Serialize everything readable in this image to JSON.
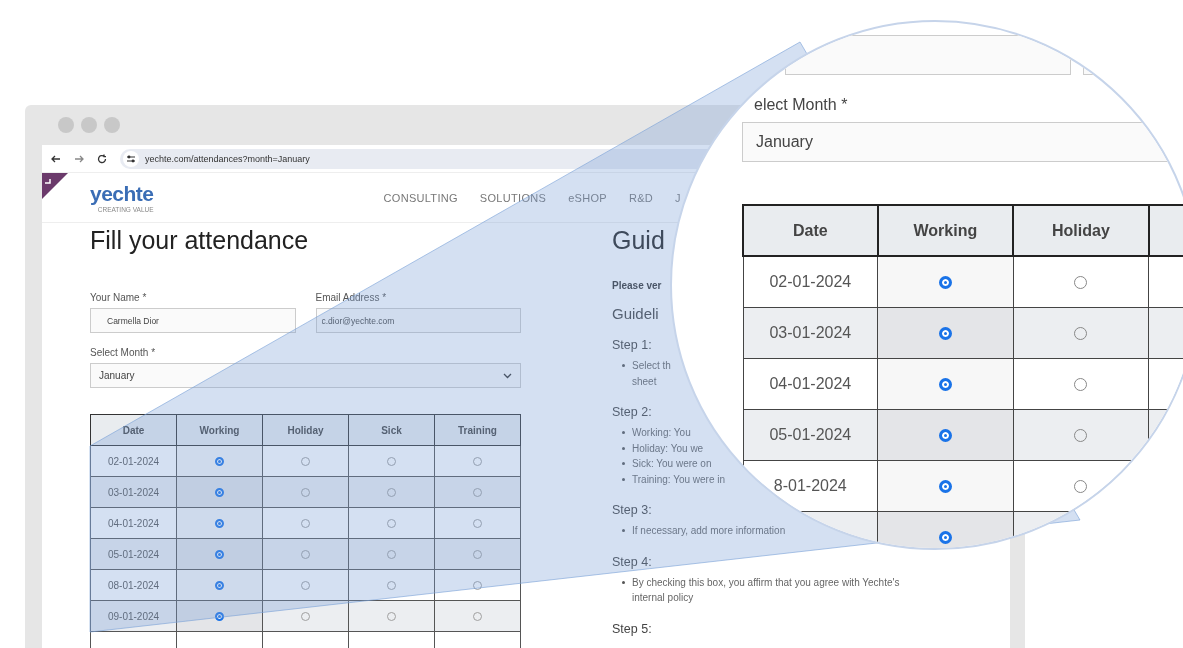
{
  "browser": {
    "url": "yechte.com/attendances?month=January"
  },
  "site": {
    "logo": "yechte",
    "tagline": "CREATING VALUE",
    "nav": [
      "CONSULTING",
      "SOLUTIONS",
      "eSHOP",
      "R&D",
      "J"
    ]
  },
  "form": {
    "title": "Fill your attendance",
    "fields": [
      {
        "label": "Your Name *",
        "value": "Carmella Dior"
      },
      {
        "label": "Email Address *",
        "value": "c.dior@yechte.com"
      }
    ],
    "month": {
      "label": "Select Month *",
      "value": "January"
    },
    "columns": [
      "Date",
      "Working",
      "Holiday",
      "Sick",
      "Training"
    ],
    "rows": [
      {
        "date": "02-01-2024",
        "choices": [
          {
            "selected": true
          },
          {
            "selected": false
          },
          {
            "selected": false
          },
          {
            "selected": false
          }
        ]
      },
      {
        "date": "03-01-2024",
        "choices": [
          {
            "selected": true
          },
          {
            "selected": false
          },
          {
            "selected": false
          },
          {
            "selected": false
          }
        ]
      },
      {
        "date": "04-01-2024",
        "choices": [
          {
            "selected": true
          },
          {
            "selected": false
          },
          {
            "selected": false
          },
          {
            "selected": false
          }
        ]
      },
      {
        "date": "05-01-2024",
        "choices": [
          {
            "selected": true
          },
          {
            "selected": false
          },
          {
            "selected": false
          },
          {
            "selected": false
          }
        ]
      },
      {
        "date": "08-01-2024",
        "choices": [
          {
            "selected": true
          },
          {
            "selected": false
          },
          {
            "selected": false
          },
          {
            "selected": false
          }
        ]
      },
      {
        "date": "09-01-2024",
        "choices": [
          {
            "selected": true
          },
          {
            "selected": false
          },
          {
            "selected": false
          },
          {
            "selected": false
          }
        ]
      }
    ]
  },
  "guidelines": {
    "title": "Guid",
    "intro": "Please ver",
    "subtitle": "Guideli",
    "steps": [
      {
        "title": "Step 1:",
        "items": [
          {
            "lines": [
              "Select th",
              "sheet"
            ]
          }
        ]
      },
      {
        "title": "Step 2:",
        "items": [
          {
            "lines": [
              "Working: You"
            ]
          },
          {
            "lines": [
              "Holiday: You we"
            ]
          },
          {
            "lines": [
              "Sick: You were on"
            ]
          },
          {
            "lines": [
              "Training: You were in"
            ]
          }
        ]
      },
      {
        "title": "Step 3:",
        "items": [
          {
            "lines": [
              "If necessary, add more information"
            ]
          }
        ]
      },
      {
        "title": "Step 4:",
        "items": [
          {
            "lines": [
              "By checking this box, you affirm that you agree with Yechte's",
              "internal policy"
            ]
          }
        ]
      },
      {
        "title": "Step 5:"
      }
    ]
  },
  "magnifier": {
    "month_label": "elect Month *",
    "month_value": "January",
    "columns": [
      "Date",
      "Working",
      "Holiday"
    ],
    "rows": [
      {
        "date": "02-01-2024",
        "choices": [
          {
            "selected": true
          },
          {
            "selected": false
          }
        ]
      },
      {
        "date": "03-01-2024",
        "choices": [
          {
            "selected": true
          },
          {
            "selected": false
          }
        ]
      },
      {
        "date": "04-01-2024",
        "choices": [
          {
            "selected": true
          },
          {
            "selected": false
          }
        ]
      },
      {
        "date": "05-01-2024",
        "choices": [
          {
            "selected": true
          },
          {
            "selected": false
          }
        ]
      },
      {
        "date": "8-01-2024",
        "choices": [
          {
            "selected": true
          },
          {
            "selected": false
          }
        ]
      },
      {
        "choices": [
          {
            "selected": true
          }
        ]
      }
    ]
  }
}
